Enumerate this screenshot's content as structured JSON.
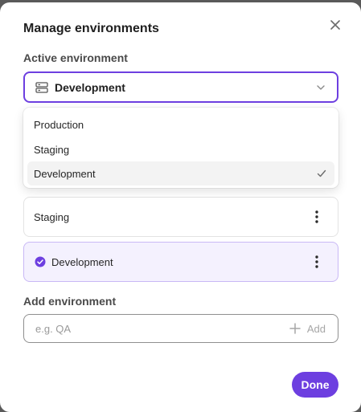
{
  "dialog": {
    "title": "Manage environments"
  },
  "active_environment": {
    "label": "Active environment",
    "selected_value": "Development",
    "options": [
      {
        "label": "Production",
        "selected": false
      },
      {
        "label": "Staging",
        "selected": false
      },
      {
        "label": "Development",
        "selected": true
      }
    ]
  },
  "environments": [
    {
      "name": "Staging",
      "active": false
    },
    {
      "name": "Development",
      "active": true
    }
  ],
  "add_environment": {
    "label": "Add environment",
    "placeholder": "e.g. QA",
    "value": "",
    "button_label": "Add"
  },
  "footer": {
    "done_label": "Done"
  },
  "colors": {
    "accent": "#6d3fe0",
    "active_card_bg": "#f4f1fe"
  },
  "icons": {
    "close": "close-icon",
    "select": "server-icon",
    "chevron": "chevron-down-icon",
    "check": "check-icon",
    "active": "check-circle-icon",
    "more": "more-vertical-icon",
    "add": "plus-icon"
  }
}
